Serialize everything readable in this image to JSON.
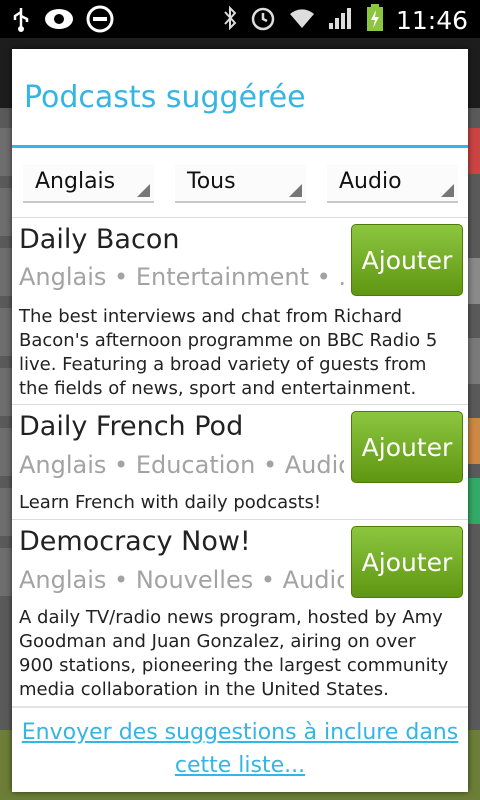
{
  "status_bar": {
    "time": "11:46",
    "icons": [
      "usb-icon",
      "visibility-icon",
      "do-not-disturb-icon",
      "bluetooth-icon",
      "alarm-icon",
      "wifi-icon",
      "signal-icon",
      "battery-charging-icon"
    ]
  },
  "dialog": {
    "title": "Podcasts suggérée",
    "filters": {
      "language": "Anglais",
      "category": "Tous",
      "media_type": "Audio"
    },
    "items": [
      {
        "title": "Daily Bacon",
        "meta": "Anglais • Entertainment • ...",
        "description": "The best interviews and chat from Richard Bacon's afternoon programme on BBC Radio 5 live. Featuring a broad variety of guests from the fields of news, sport and entertainment.",
        "button_label": "Ajouter"
      },
      {
        "title": "Daily French Pod",
        "meta": "Anglais • Education • Audio",
        "description": "Learn French with daily podcasts!",
        "button_label": "Ajouter"
      },
      {
        "title": "Democracy Now!",
        "meta": "Anglais • Nouvelles • Audio",
        "description": "A daily TV/radio news program, hosted by Amy Goodman and Juan Gonzalez, airing on over 900 stations, pioneering the largest community media collaboration in the United States.",
        "button_label": "Ajouter"
      }
    ],
    "footer_link": "Envoyer des suggestions à inclure dans cette liste..."
  },
  "colors": {
    "accent": "#33b5e5",
    "button_green": "#6fa31a",
    "meta_gray": "#a3a3a3"
  }
}
